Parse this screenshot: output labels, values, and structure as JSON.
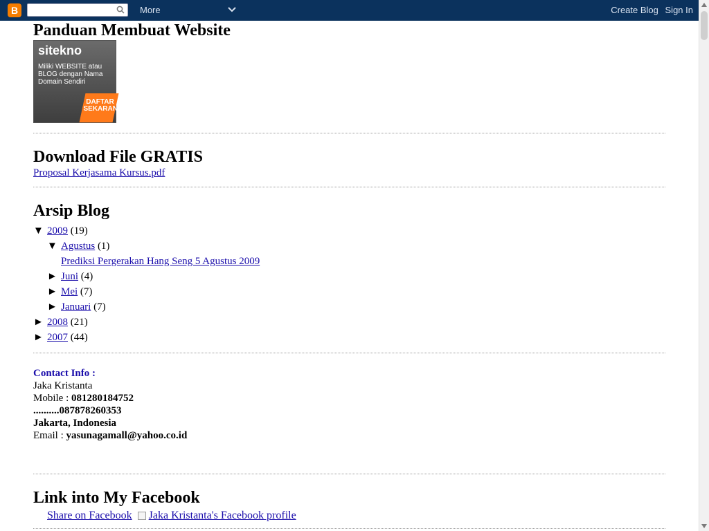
{
  "navbar": {
    "search_placeholder": "",
    "more_label": "More",
    "create_blog": "Create Blog",
    "sign_in": "Sign In",
    "logo_letter": "B"
  },
  "sections": {
    "page_title": "Panduan Membuat Website",
    "ad": {
      "brand": "sitekno",
      "text": "Miliki WEBSITE atau BLOG dengan Nama Domain Sendiri",
      "cta": "DAFTAR SEKARANG"
    },
    "download_title": "Download File GRATIS",
    "download_link": "Proposal Kerjasama Kursus.pdf",
    "archive_title": "Arsip Blog",
    "archive": [
      {
        "level": 1,
        "toggle": "▼",
        "label": "2009",
        "count": "(19)"
      },
      {
        "level": 2,
        "toggle": "▼",
        "label": "Agustus",
        "count": "(1)"
      },
      {
        "level": 3,
        "toggle": "",
        "label": "Prediksi Pergerakan Hang Seng 5 Agustus 2009",
        "count": ""
      },
      {
        "level": 2,
        "toggle": "►",
        "label": "Juni",
        "count": "(4)"
      },
      {
        "level": 2,
        "toggle": "►",
        "label": "Mei",
        "count": "(7)"
      },
      {
        "level": 2,
        "toggle": "►",
        "label": "Januari",
        "count": "(7)"
      },
      {
        "level": 1,
        "toggle": "►",
        "label": "2008",
        "count": "(21)"
      },
      {
        "level": 1,
        "toggle": "►",
        "label": "2007",
        "count": "(44)"
      }
    ],
    "contact": {
      "head": "Contact Info :",
      "name": "Jaka Kristanta",
      "mobile_prefix": "Mobile : ",
      "mobile": "081280184752",
      "mobile2": "..........087878260353",
      "city": "Jakarta, Indonesia",
      "email_prefix": "Email : ",
      "email": "yasunagamall@yahoo.co.id"
    },
    "facebook_title": "Link into My Facebook",
    "facebook_share": "Share on Facebook",
    "facebook_profile": "Jaka Kristanta's Facebook profile"
  }
}
